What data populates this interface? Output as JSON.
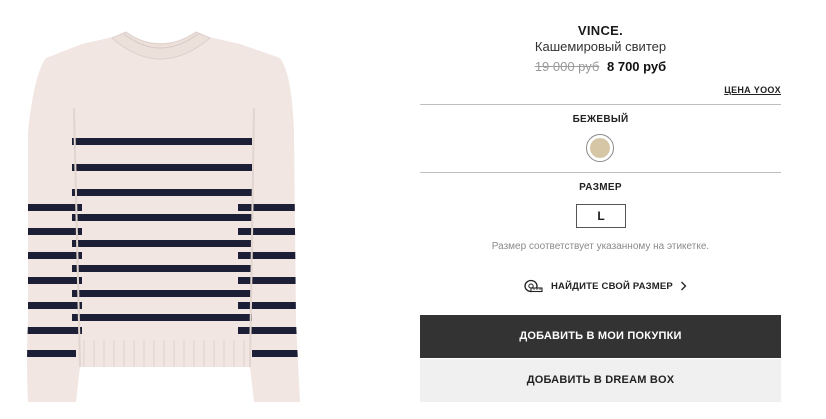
{
  "product": {
    "brand": "VINCE.",
    "name": "Кашемировый свитер",
    "old_price": "19 000 руб",
    "new_price": "8 700 руб",
    "price_note": "ЦЕНА YOOX",
    "image_icon": "striped-sweater-image"
  },
  "color": {
    "label": "БЕЖЕВЫЙ",
    "swatch_color": "#d6c6a6"
  },
  "size": {
    "label": "РАЗМЕР",
    "selected": "L",
    "note": "Размер соответствует указанному на этикетке.",
    "find_size_label": "НАЙДИТЕ СВОЙ РАЗМЕР",
    "find_size_icon": "measuring-tape-icon"
  },
  "actions": {
    "add_to_cart": "ДОБАВИТЬ В МОИ ПОКУПКИ",
    "add_to_dreambox": "ДОБАВИТЬ В DREAM BOX"
  },
  "colors": {
    "primary_button": "#333333",
    "secondary_button": "#f0f0f0",
    "sweater": "#f1e6e2",
    "stripe": "#1c1f35"
  }
}
